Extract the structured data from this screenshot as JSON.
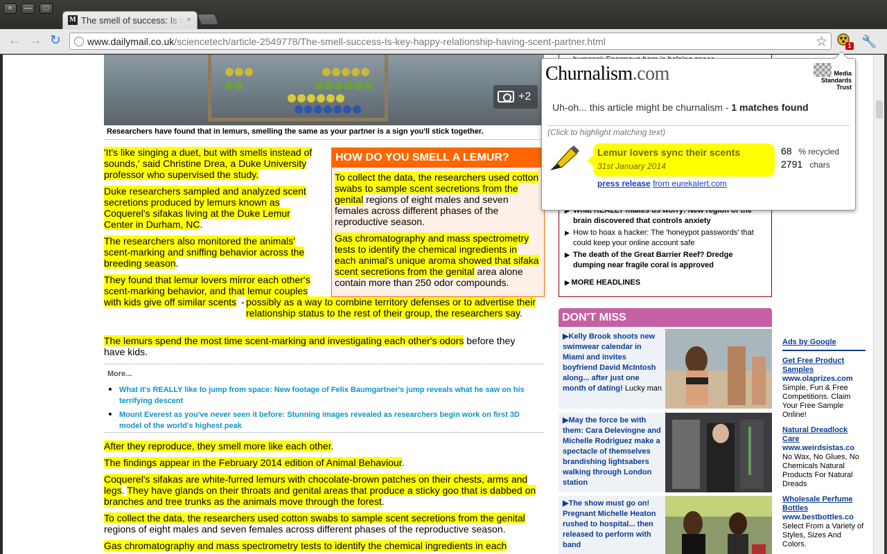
{
  "window": {
    "tab_title": "The smell of success: Is the",
    "tab_favicon": "M",
    "close_glyph": "×",
    "min_glyph": "—",
    "max_glyph": "□",
    "tab_close_glyph": "×"
  },
  "toolbar": {
    "back_glyph": "←",
    "forward_glyph": "→",
    "reload_glyph": "↻",
    "url_host": "www.dailymail.co.uk",
    "url_path": "/sciencetech/article-2549778/The-smell-success-Is-key-happy-relationship-having-scent-partner.html",
    "star_glyph": "☆",
    "ext_badge": "1",
    "wrench_glyph": "🔧"
  },
  "hero": {
    "photo_count": "+2",
    "caption": "Researchers have found that in lemurs, smelling the same as your partner is a sign you'll stick together."
  },
  "article": {
    "p1": "'It's like singing a duet, but with smells instead of sounds,' said Christine Drea, a Duke University professor who supervised the study.",
    "p2": "Duke researchers sampled and analyzed scent secretions produced by lemurs known as Coquerel's sifakas living at the Duke Lemur Center in Durham, NC",
    "p3": "The researchers also monitored the animals' scent-marking and sniffing behavior across the breeding season",
    "p4a": "They found that lemur lovers mirror each other's scent-marking behavior, and that lemur couples with kids give off similar scents",
    "p4b": "possibly as a way to combine territory defenses or to advertise their relationship status to the rest of their group, the researchers say",
    "p5a": "The lemurs spend the most time scent-marking and investigating each other's odors",
    "p5b": " before they have kids.",
    "p6": "After they reproduce, they smell more like each other",
    "p7": "The findings appear in the February 2014 edition of Animal Behaviour",
    "p8a": "Coquerel's sifakas are white-furred lemurs with chocolate-brown patches on their chests, arms and legs",
    "p8b": "They have glands on their throats and genital areas that produce a sticky goo that is dabbed on branches and tree trunks as the animals move through the forest",
    "p9a": "To collect the data, the researchers used cotton swabs to sample scent secretions from the genital",
    "p9b": " regions of eight males and seven females across different phases of the reproductive season.",
    "p10": "Gas chromatography and mass spectrometry tests to identify the chemical ingredients in each"
  },
  "factbox": {
    "title": "HOW DO YOU SMELL A LEMUR?",
    "f1a": "To collect the data, the researchers used cotton swabs to sample scent secretions from the genital",
    "f1b": " regions of eight males and seven females across different phases of the reproductive season.",
    "f2a": "Gas chromatography and mass spectrometry tests to identify the chemical ingredients in each animal's unique aroma showed that sifaka scent secretions from the genital",
    "f2b": " area alone contain more than 250 odor compounds."
  },
  "more": {
    "title": "More...",
    "items": [
      "What it's REALLY like to jump from space: New footage of Felix Baumgartner's jump reveals what he saw on his terrifying descent",
      "Mount Everest as you've never seen it before: Stunning images revealed as researchers begin work on first 3D model of the world's highest peak"
    ]
  },
  "headlines": {
    "top_partial": "humans': Enormous horn is helping space",
    "items": [
      "What REALLY makes us worry: New region of the brain discovered that controls anxiety",
      "How to hoax a hacker: The 'honeypot passwords' that could keep your online account safe",
      "The death of the Great Barrier Reef? Dredge dumping near fragile coral is approved"
    ],
    "more_label": "MORE HEADLINES"
  },
  "dont_miss": {
    "title": "DON'T MISS",
    "items": [
      {
        "headline": "Kelly Brook shoots new swimwear calendar in Miami and invites boyfriend David McIntosh along... after just one month of dating!",
        "sub": "Lucky man"
      },
      {
        "headline": "May the force be with them: Cara Delevingne and Michelle Rodriguez make a spectacle of themselves brandishing lightsabers walking through London station",
        "sub": ""
      },
      {
        "headline": "The show must go on! Pregnant Michelle Heaton rushed to hospital... then released to perform with band",
        "sub": ""
      }
    ]
  },
  "ads": {
    "label": "Ads by Google",
    "items": [
      {
        "title": "Get Free Product Samples",
        "url": "www.olaprizes.com",
        "desc": "Simple, Fun & Free Competitions. Claim Your Free Sample Online!"
      },
      {
        "title": "Natural Dreadlock Care",
        "url": "www.weirdsistas.co",
        "desc": "No Wax, No Glues, No Chemicals Natural Products For Natural Dreads"
      },
      {
        "title": "Wholesale Perfume Bottles",
        "url": "www.bestbottles.co",
        "desc": "Select From a Variety of Styles, Sizes And Colors."
      }
    ]
  },
  "churnalism": {
    "logo_main": "Churnalism",
    "logo_com": ".com",
    "mst": "Media Standards Trust",
    "message_pre": "Uh-oh... this article might be churnalism - ",
    "message_bold": "1 matches found",
    "hint": "(Click to highlight matching text)",
    "match_title": "Lemur lovers sync their scents",
    "match_date": "31st January 2014",
    "pct": "68",
    "pct_label": "% recycled",
    "chars": "2791",
    "chars_label": "chars",
    "link_type": "press release",
    "link_source": "from eurekalert.com"
  }
}
